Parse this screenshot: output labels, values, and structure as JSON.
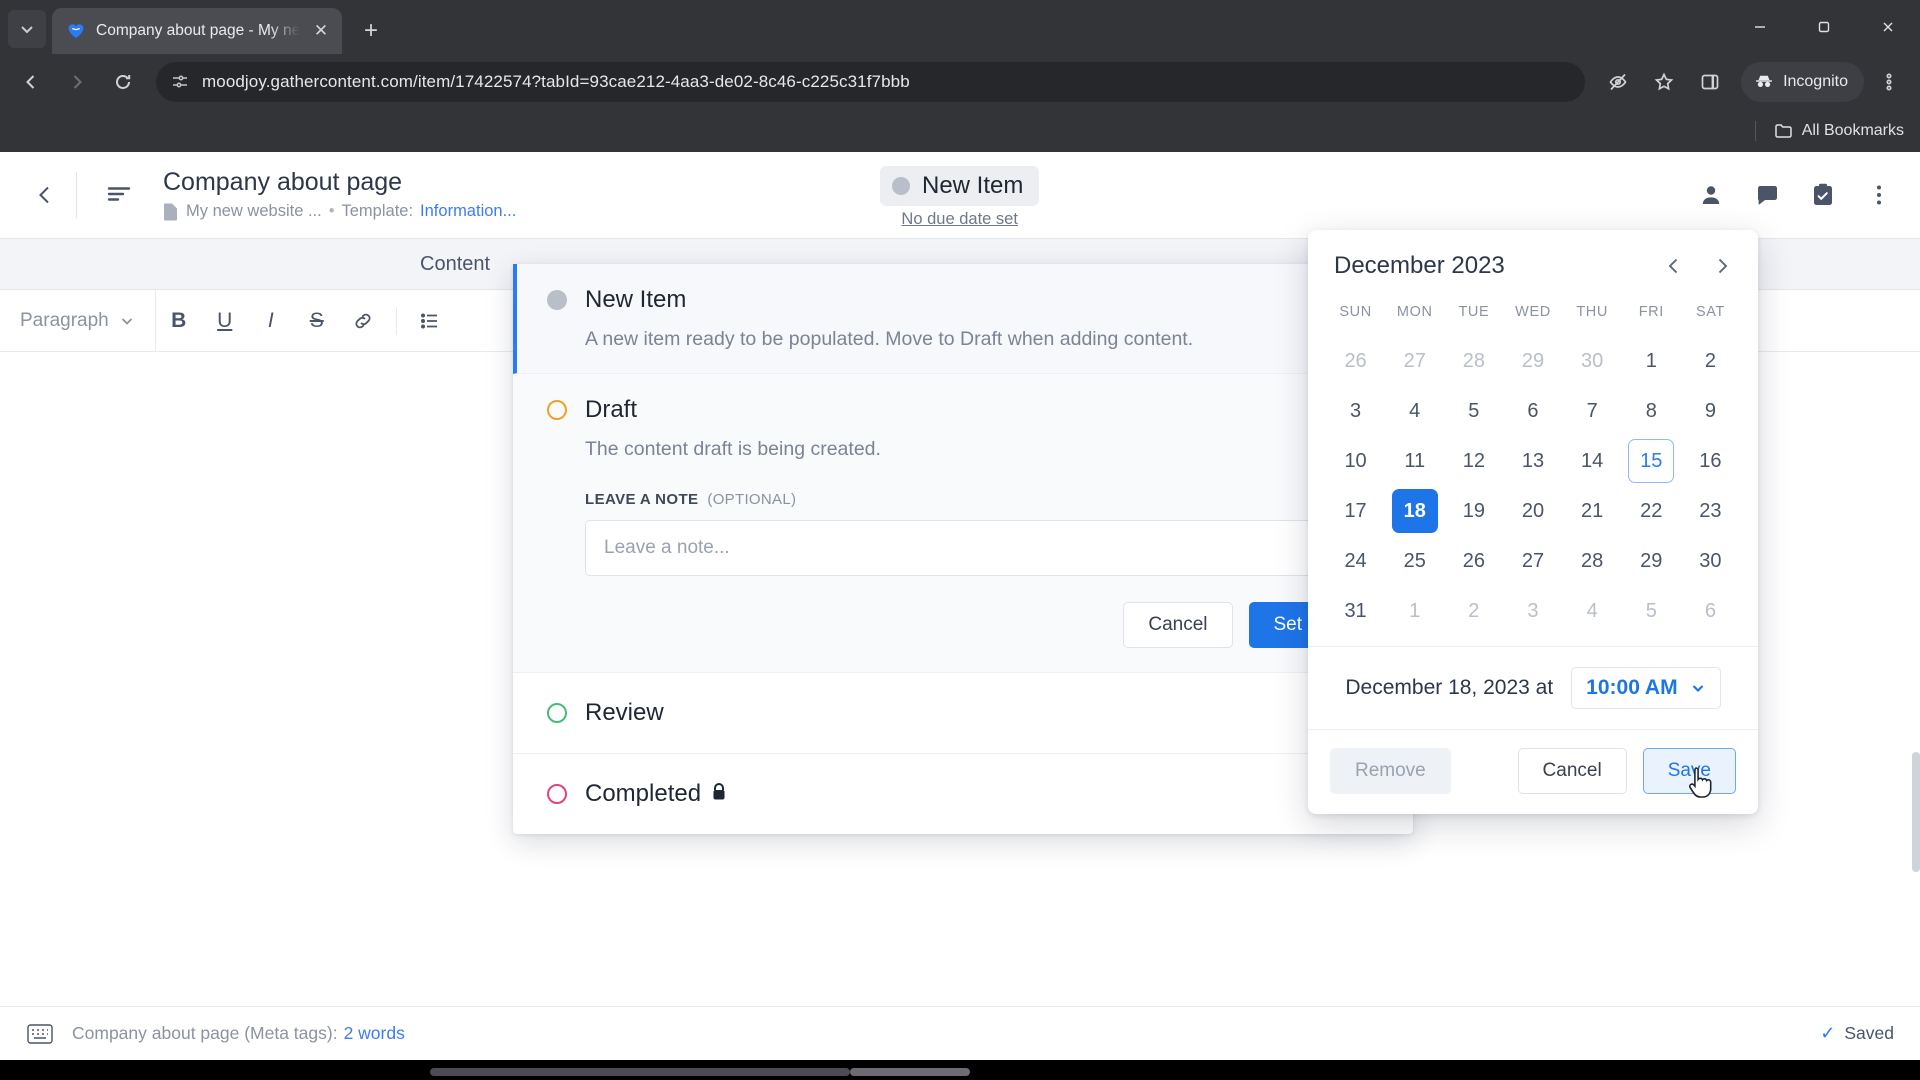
{
  "browser": {
    "tab": {
      "title": "Company about page - My new",
      "favicon_name": "gathercontent-heart-favicon",
      "close_label": "✕"
    },
    "new_tab_label": "+",
    "tab_search_icon": "chevron-down-icon",
    "window_controls": {
      "minimize": "minimize",
      "maximize": "maximize",
      "close": "close"
    },
    "omnibox": {
      "url": "moodjoy.gathercontent.com/item/17422574?tabId=93cae212-4aa3-de02-8c46-c225c31f7bbb",
      "site_info_icon": "site-settings-icon"
    },
    "toolbar_icons": [
      "eye-slash-icon",
      "bookmark-star-icon",
      "side-panel-icon",
      "more-vertical-icon"
    ],
    "incognito_label": "Incognito",
    "bookmarks": {
      "all_label": "All Bookmarks",
      "folder_icon": "folder-icon"
    }
  },
  "header": {
    "back_icon": "chevron-left-icon",
    "outline_icon": "outline-lines-icon",
    "title": "Company about page",
    "folder_icon": "document-icon",
    "project": "My new website ...",
    "separator": "•",
    "template_prefix": "Template:",
    "template_name": "Information...",
    "status": {
      "label": "New Item",
      "dot_color": "#b9bfc9"
    },
    "due_date": "No due date set",
    "right_icons": [
      "person-icon",
      "comment-icon",
      "tasks-clipboard-icon",
      "more-vertical-icon"
    ]
  },
  "editor": {
    "content_tab": "Content",
    "paragraph_select": "Paragraph",
    "format_buttons": [
      "B",
      "U",
      "I",
      "S",
      "link-icon",
      "list-icon"
    ]
  },
  "status_panel": {
    "rows": [
      {
        "name": "New Item",
        "description": "A new item ready to be populated. Move to Draft when adding content.",
        "dot_color": "#b9bfc9",
        "state": "active"
      },
      {
        "name": "Draft",
        "description": "The content draft is being created.",
        "dot_color": "#f0a12a",
        "state": "selected"
      },
      {
        "name": "Review",
        "description": "",
        "dot_color": "#45bd7a",
        "state": "plain"
      },
      {
        "name": "Completed",
        "description": "",
        "dot_color": "#e0457b",
        "state": "plain",
        "locked": true
      }
    ],
    "note_label": "LEAVE A NOTE",
    "note_optional": "(OPTIONAL)",
    "note_placeholder": "Leave a note...",
    "cancel_label": "Cancel",
    "submit_label": "Set status"
  },
  "datepicker": {
    "month_title": "December 2023",
    "prev_icon": "chevron-left-icon",
    "next_icon": "chevron-right-icon",
    "day_headers": [
      "SUN",
      "MON",
      "TUE",
      "WED",
      "THU",
      "FRI",
      "SAT"
    ],
    "weeks": [
      [
        {
          "d": "26",
          "m": true
        },
        {
          "d": "27",
          "m": true
        },
        {
          "d": "28",
          "m": true
        },
        {
          "d": "29",
          "m": true
        },
        {
          "d": "30",
          "m": true
        },
        {
          "d": "1"
        },
        {
          "d": "2"
        }
      ],
      [
        {
          "d": "3"
        },
        {
          "d": "4"
        },
        {
          "d": "5"
        },
        {
          "d": "6"
        },
        {
          "d": "7"
        },
        {
          "d": "8"
        },
        {
          "d": "9"
        }
      ],
      [
        {
          "d": "10"
        },
        {
          "d": "11"
        },
        {
          "d": "12"
        },
        {
          "d": "13"
        },
        {
          "d": "14"
        },
        {
          "d": "15",
          "today": true
        },
        {
          "d": "16"
        }
      ],
      [
        {
          "d": "17"
        },
        {
          "d": "18",
          "selected": true
        },
        {
          "d": "19"
        },
        {
          "d": "20"
        },
        {
          "d": "21"
        },
        {
          "d": "22"
        },
        {
          "d": "23"
        }
      ],
      [
        {
          "d": "24"
        },
        {
          "d": "25"
        },
        {
          "d": "26"
        },
        {
          "d": "27"
        },
        {
          "d": "28"
        },
        {
          "d": "29"
        },
        {
          "d": "30"
        }
      ],
      [
        {
          "d": "31"
        },
        {
          "d": "1",
          "m": true
        },
        {
          "d": "2",
          "m": true
        },
        {
          "d": "3",
          "m": true
        },
        {
          "d": "4",
          "m": true
        },
        {
          "d": "5",
          "m": true
        },
        {
          "d": "6",
          "m": true
        }
      ]
    ],
    "selected_date_text": "December 18, 2023 at",
    "selected_time": "10:00 AM",
    "time_chevron_icon": "chevron-down-icon",
    "remove_label": "Remove",
    "cancel_label": "Cancel",
    "save_label": "Save",
    "colors": {
      "selected": "#1e75e8",
      "today_border": "#8fb9f7",
      "accent": "#1e75e8"
    }
  },
  "bottom_bar": {
    "keyboard_icon": "keyboard-icon",
    "field_text": "Company about page (Meta tags):",
    "word_count": "2 words",
    "saved_label": "Saved",
    "check_icon": "check-icon"
  }
}
